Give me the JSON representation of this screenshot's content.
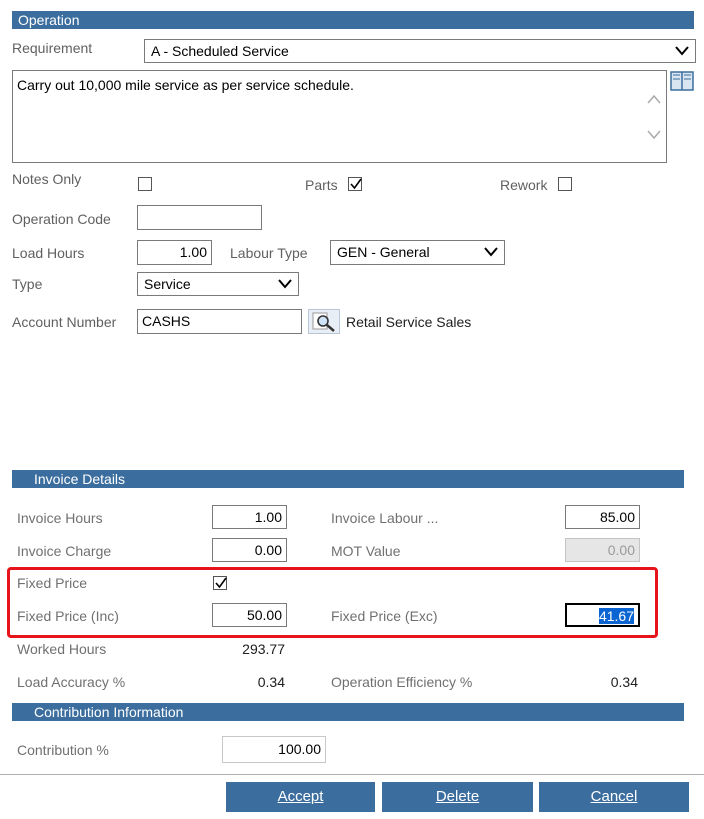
{
  "operation": {
    "section_title": "Operation",
    "requirement_label": "Requirement",
    "requirement_value": "A - Scheduled Service",
    "notes_text": "Carry out 10,000 mile service as per service schedule.",
    "notes_only_label": "Notes Only",
    "notes_only_checked": false,
    "parts_label": "Parts",
    "parts_checked": true,
    "rework_label": "Rework",
    "rework_checked": false,
    "operation_code_label": "Operation Code",
    "operation_code_value": "",
    "load_hours_label": "Load Hours",
    "load_hours_value": "1.00",
    "labour_type_label": "Labour Type",
    "labour_type_value": "GEN - General",
    "type_label": "Type",
    "type_value": "Service",
    "account_number_label": "Account Number",
    "account_number_value": "CASHS",
    "account_name": "Retail Service Sales"
  },
  "invoice": {
    "section_title": "Invoice Details",
    "invoice_hours_label": "Invoice Hours",
    "invoice_hours_value": "1.00",
    "invoice_labour_label": "Invoice Labour ...",
    "invoice_labour_value": "85.00",
    "invoice_charge_label": "Invoice Charge",
    "invoice_charge_value": "0.00",
    "mot_value_label": "MOT Value",
    "mot_value_value": "0.00",
    "fixed_price_label": "Fixed Price",
    "fixed_price_checked": true,
    "fixed_price_inc_label": "Fixed Price (Inc)",
    "fixed_price_inc_value": "50.00",
    "fixed_price_exc_label": "Fixed Price (Exc)",
    "fixed_price_exc_value": "41.67",
    "worked_hours_label": "Worked Hours",
    "worked_hours_value": "293.77",
    "load_accuracy_label": "Load Accuracy %",
    "load_accuracy_value": "0.34",
    "operation_efficiency_label": "Operation Efficiency %",
    "operation_efficiency_value": "0.34"
  },
  "contribution": {
    "section_title": "Contribution Information",
    "contribution_label": "Contribution %",
    "contribution_value": "100.00"
  },
  "buttons": {
    "accept": "Accept",
    "delete": "Delete",
    "cancel": "Cancel"
  },
  "colors": {
    "header_bar": "#3b6e9e",
    "highlight": "#e8141b",
    "selection": "#0a64d2"
  }
}
